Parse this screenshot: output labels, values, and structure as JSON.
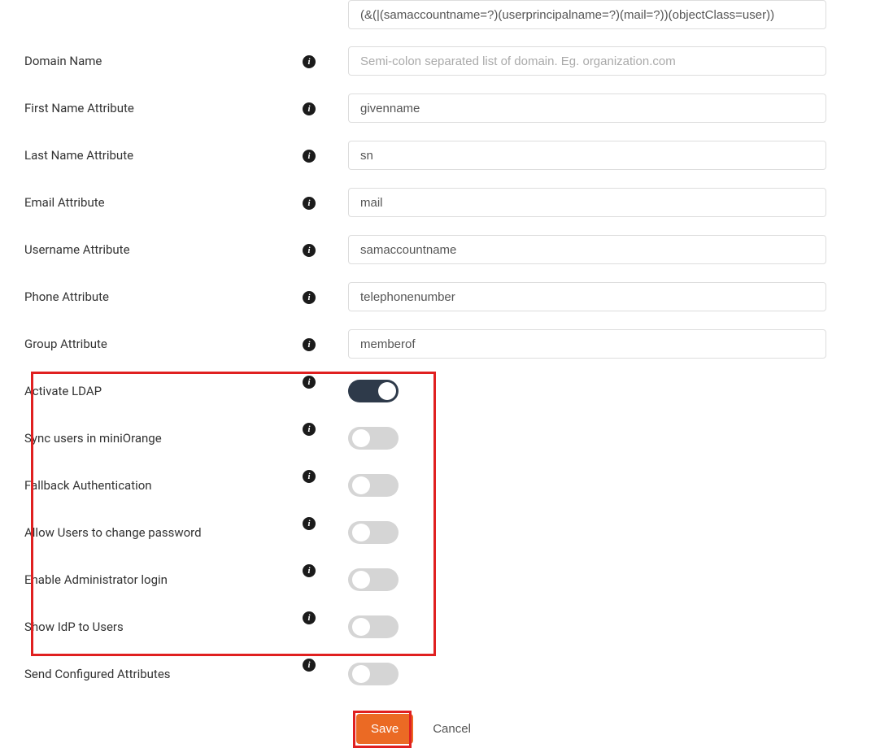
{
  "fields": {
    "searchFilter": {
      "value": "(&(|(samaccountname=?)(userprincipalname=?)(mail=?))(objectClass=user))"
    },
    "domainName": {
      "label": "Domain Name",
      "value": "",
      "placeholder": "Semi-colon separated list of domain. Eg. organization.com"
    },
    "firstName": {
      "label": "First Name Attribute",
      "value": "givenname"
    },
    "lastName": {
      "label": "Last Name Attribute",
      "value": "sn"
    },
    "email": {
      "label": "Email Attribute",
      "value": "mail"
    },
    "username": {
      "label": "Username Attribute",
      "value": "samaccountname"
    },
    "phone": {
      "label": "Phone Attribute",
      "value": "telephonenumber"
    },
    "group": {
      "label": "Group Attribute",
      "value": "memberof"
    }
  },
  "toggles": {
    "activateLdap": {
      "label": "Activate LDAP",
      "on": true
    },
    "syncUsers": {
      "label": "Sync users in miniOrange",
      "on": false
    },
    "fallbackAuth": {
      "label": "Fallback Authentication",
      "on": false
    },
    "allowChangePassword": {
      "label": "Allow Users to change password",
      "on": false
    },
    "enableAdminLogin": {
      "label": "Enable Administrator login",
      "on": false
    },
    "showIdp": {
      "label": "Show IdP to Users",
      "on": false
    },
    "sendAttributes": {
      "label": "Send Configured Attributes",
      "on": false
    }
  },
  "buttons": {
    "save": "Save",
    "cancel": "Cancel"
  }
}
